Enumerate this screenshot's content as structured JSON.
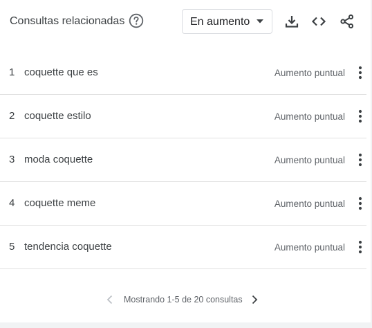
{
  "header": {
    "title": "Consultas relacionadas",
    "filter": {
      "selected": "En aumento"
    },
    "icons": {
      "help": "help-circle-icon",
      "dropdown": "caret-down-icon",
      "download": "download-icon",
      "embed": "code-icon",
      "share": "share-icon"
    }
  },
  "rows": [
    {
      "rank": "1",
      "query": "coquette que es",
      "value": "Aumento puntual"
    },
    {
      "rank": "2",
      "query": "coquette estilo",
      "value": "Aumento puntual"
    },
    {
      "rank": "3",
      "query": "moda coquette",
      "value": "Aumento puntual"
    },
    {
      "rank": "4",
      "query": "coquette meme",
      "value": "Aumento puntual"
    },
    {
      "rank": "5",
      "query": "tendencia coquette",
      "value": "Aumento puntual"
    }
  ],
  "pagination": {
    "text": "Mostrando 1-5 de 20 consultas"
  },
  "colors": {
    "text": "#3c4043",
    "secondary": "#5f6368",
    "icon": "#5f6368",
    "divider": "#e0e0e0",
    "disabled": "#bdc1c6"
  }
}
